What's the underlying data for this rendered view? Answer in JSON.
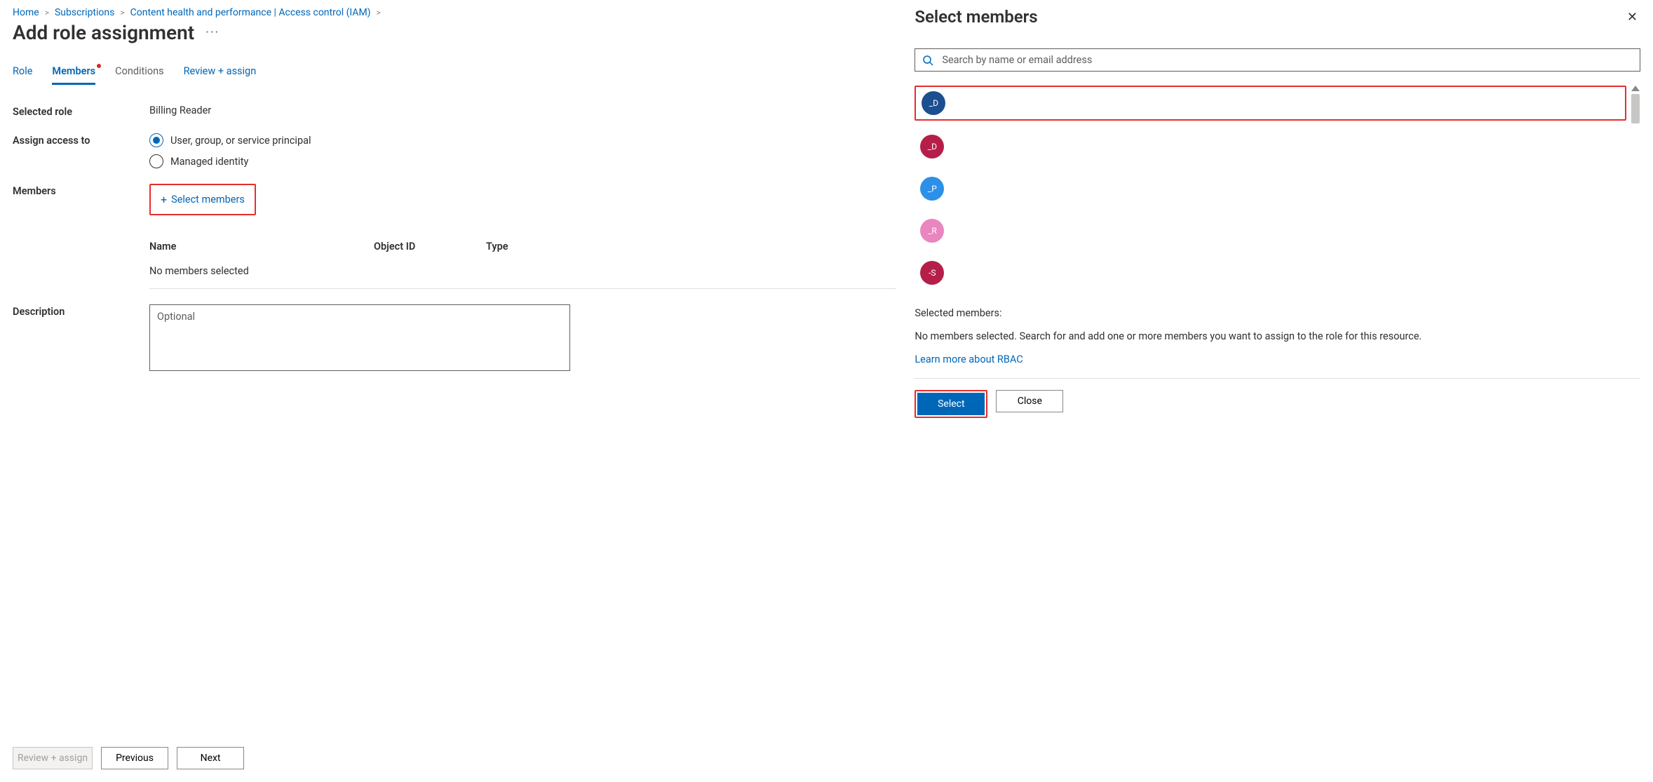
{
  "breadcrumb": {
    "items": [
      "Home",
      "Subscriptions",
      "Content health and performance | Access control (IAM)"
    ]
  },
  "page_title": "Add role assignment",
  "tabs": {
    "role": "Role",
    "members": "Members",
    "conditions": "Conditions",
    "review": "Review + assign"
  },
  "form": {
    "selected_role_label": "Selected role",
    "selected_role_value": "Billing Reader",
    "assign_access_label": "Assign access to",
    "radio_user_label": "User, group, or service principal",
    "radio_mi_label": "Managed identity",
    "members_label": "Members",
    "select_members_link": "Select members",
    "description_label": "Description",
    "description_placeholder": "Optional"
  },
  "members_table": {
    "col_name": "Name",
    "col_object_id": "Object ID",
    "col_type": "Type",
    "empty_text": "No members selected"
  },
  "footer": {
    "review_assign": "Review + assign",
    "previous": "Previous",
    "next": "Next"
  },
  "pane": {
    "title": "Select members",
    "search_placeholder": "Search by name or email address",
    "results": [
      {
        "initials": "_D",
        "color": "#1b4f8f",
        "highlighted": true
      },
      {
        "initials": "_D",
        "color": "#b61e4a",
        "highlighted": false
      },
      {
        "initials": "_P",
        "color": "#2c90e8",
        "highlighted": false
      },
      {
        "initials": "_R",
        "color": "#e986c0",
        "highlighted": false
      },
      {
        "initials": "-S",
        "color": "#b61e4a",
        "highlighted": false
      }
    ],
    "selected_heading": "Selected members:",
    "selected_desc": "No members selected. Search for and add one or more members you want to assign to the role for this resource.",
    "learn_more": "Learn more about RBAC",
    "select_button": "Select",
    "close_button": "Close"
  }
}
